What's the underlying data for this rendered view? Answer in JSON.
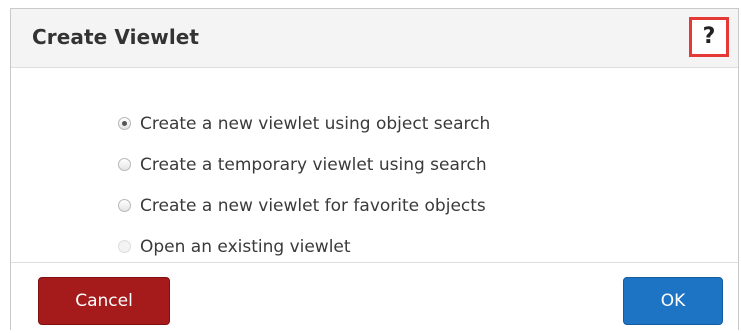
{
  "dialog": {
    "title": "Create Viewlet",
    "help_icon": "?"
  },
  "options": [
    {
      "label": "Create a new viewlet using object search",
      "state": "selected"
    },
    {
      "label": "Create a temporary viewlet using search",
      "state": "unselected"
    },
    {
      "label": "Create a new viewlet for favorite objects",
      "state": "unselected"
    },
    {
      "label": "Open an existing viewlet",
      "state": "disabled"
    }
  ],
  "footer": {
    "cancel_label": "Cancel",
    "ok_label": "OK"
  },
  "colors": {
    "cancel": "#a51a1a",
    "ok": "#1d74c4",
    "help_highlight": "#e53935"
  }
}
